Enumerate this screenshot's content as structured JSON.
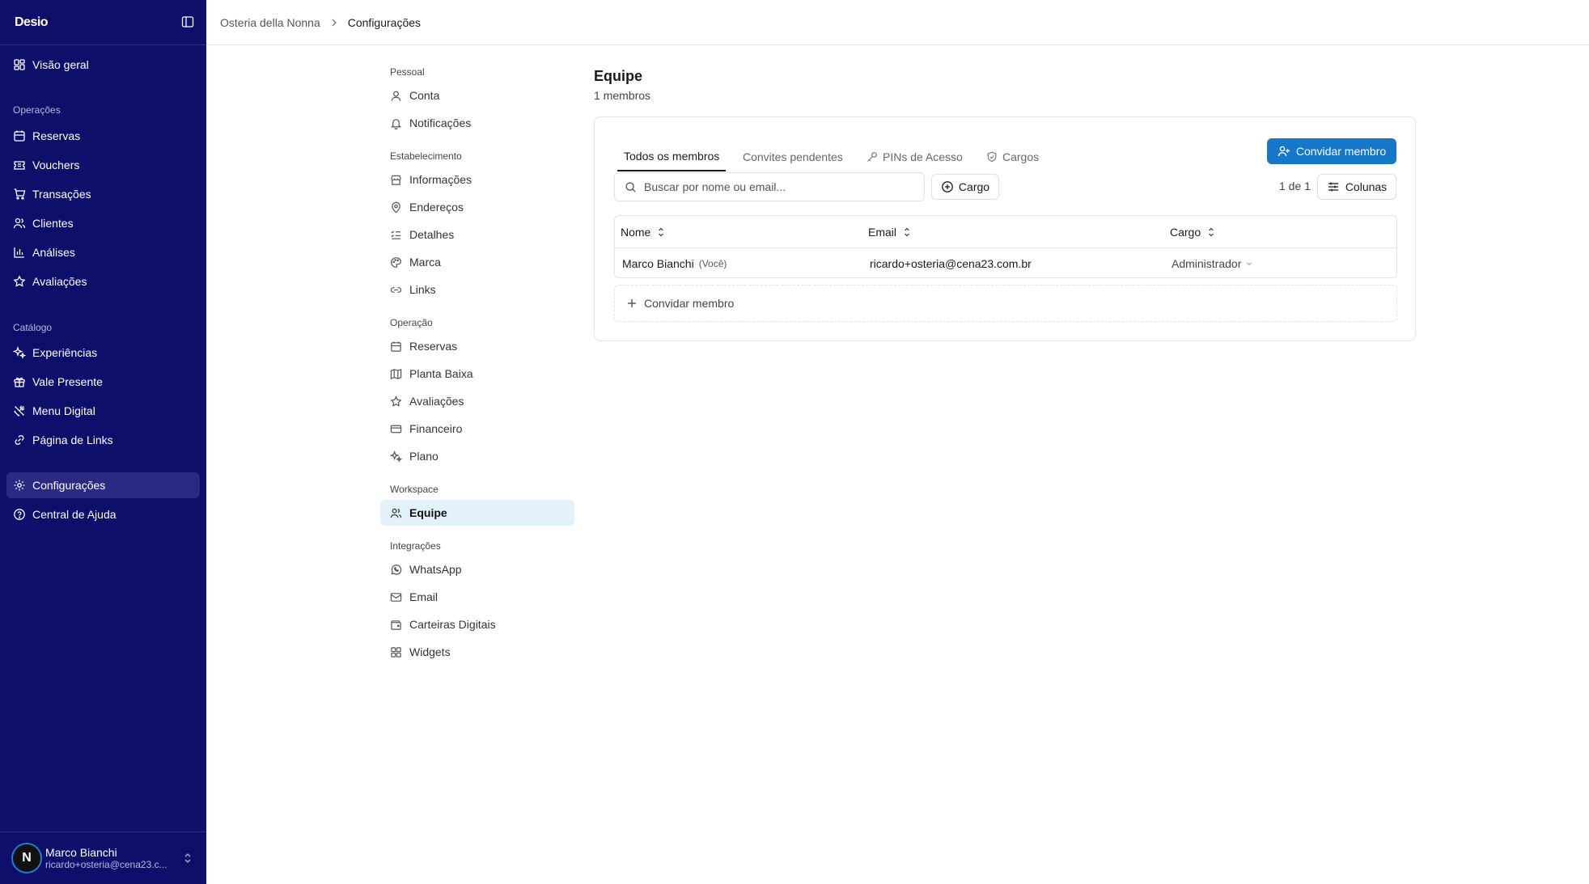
{
  "colors": {
    "sidebar_bg": "#0e0e6b",
    "sidebar_active": "#2a2a82",
    "accent": "#1677c8",
    "nav_active_bg": "#e3f1fb"
  },
  "sidebar": {
    "logo": "Desio",
    "overview": "Visão geral",
    "sections": {
      "operations": "Operações",
      "catalog": "Catálogo"
    },
    "operations_items": [
      {
        "label": "Reservas",
        "icon": "calendar-icon"
      },
      {
        "label": "Vouchers",
        "icon": "ticket-icon"
      },
      {
        "label": "Transações",
        "icon": "cart-icon"
      },
      {
        "label": "Clientes",
        "icon": "users-icon"
      },
      {
        "label": "Análises",
        "icon": "bar-chart-icon"
      },
      {
        "label": "Avaliações",
        "icon": "star-icon"
      }
    ],
    "catalog_items": [
      {
        "label": "Experiências",
        "icon": "sparkles-icon"
      },
      {
        "label": "Vale Presente",
        "icon": "gift-icon"
      },
      {
        "label": "Menu Digital",
        "icon": "utensils-icon"
      },
      {
        "label": "Página de Links",
        "icon": "link-icon"
      }
    ],
    "settings": "Configurações",
    "help": "Central de Ajuda",
    "user": {
      "initial": "N",
      "name": "Marco Bianchi",
      "email": "ricardo+osteria@cena23.c..."
    }
  },
  "breadcrumb": {
    "parent": "Osteria della Nonna",
    "current": "Configurações"
  },
  "settings_nav": {
    "personal": {
      "title": "Pessoal",
      "items": [
        "Conta",
        "Notificações"
      ]
    },
    "establishment": {
      "title": "Estabelecimento",
      "items": [
        "Informações",
        "Endereços",
        "Detalhes",
        "Marca",
        "Links"
      ]
    },
    "operation": {
      "title": "Operação",
      "items": [
        "Reservas",
        "Planta Baixa",
        "Avaliações",
        "Financeiro",
        "Plano"
      ]
    },
    "workspace": {
      "title": "Workspace",
      "items": [
        "Equipe"
      ]
    },
    "integrations": {
      "title": "Integrações",
      "items": [
        "WhatsApp",
        "Email",
        "Carteiras Digitais",
        "Widgets"
      ]
    }
  },
  "main": {
    "title": "Equipe",
    "subtitle": "1 membros",
    "tabs": [
      "Todos os membros",
      "Convites pendentes",
      "PINs de Acesso",
      "Cargos"
    ],
    "invite_button": "Convidar membro",
    "search_placeholder": "Buscar por nome ou email...",
    "filter_label": "Cargo",
    "pager": "1 de 1",
    "columns_button": "Colunas",
    "table": {
      "headers": [
        "Nome",
        "Email",
        "Cargo"
      ],
      "rows": [
        {
          "name": "Marco Bianchi",
          "you_badge": "(Você)",
          "email": "ricardo+osteria@cena23.com.br",
          "role": "Administrador"
        }
      ]
    },
    "invite_row": "Convidar membro"
  }
}
